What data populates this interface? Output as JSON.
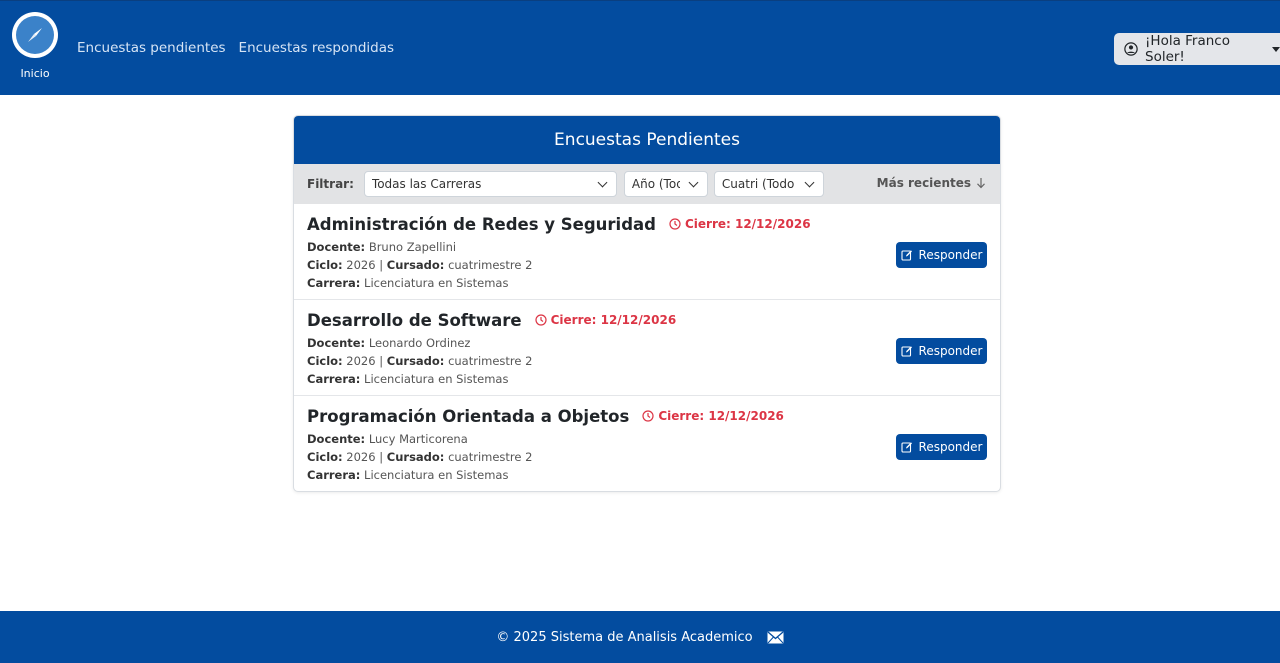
{
  "navbar": {
    "home_label": "Inicio",
    "links": [
      "Encuestas pendientes",
      "Encuestas respondidas"
    ],
    "user_greeting": "¡Hola Franco Soler!"
  },
  "card": {
    "title": "Encuestas Pendientes",
    "filter_label": "Filtrar:",
    "filters": {
      "carreras": "Todas las Carreras",
      "anio": "Año (Todos)",
      "cuatri": "Cuatri (Todos)"
    },
    "sort_label": "Más recientes"
  },
  "labels": {
    "docente": "Docente:",
    "ciclo": "Ciclo:",
    "cursado": "Cursado:",
    "carrera": "Carrera:",
    "responder": "Responder"
  },
  "encuestas": [
    {
      "materia": "Administración de Redes y Seguridad",
      "cierre": "Cierre: 12/12/2026",
      "docente": "Bruno Zapellini",
      "ciclo": "2026",
      "cursado": "cuatrimestre 2",
      "carrera": "Licenciatura en Sistemas"
    },
    {
      "materia": "Desarrollo de Software",
      "cierre": "Cierre: 12/12/2026",
      "docente": "Leonardo Ordinez",
      "ciclo": "2026",
      "cursado": "cuatrimestre 2",
      "carrera": "Licenciatura en Sistemas"
    },
    {
      "materia": "Programación Orientada a Objetos",
      "cierre": "Cierre: 12/12/2026",
      "docente": "Lucy Marticorena",
      "ciclo": "2026",
      "cursado": "cuatrimestre 2",
      "carrera": "Licenciatura en Sistemas"
    }
  ],
  "footer": {
    "text": "© 2025 Sistema de Analisis Academico"
  },
  "colors": {
    "primary": "#034c9f",
    "danger": "#dc3545",
    "filter_bg": "#e2e3e5"
  },
  "icons": [
    "compass-logo-icon",
    "user-circle-icon",
    "caret-down-icon",
    "chevron-down-icon",
    "arrow-down-icon",
    "clock-icon",
    "edit-icon",
    "envelope-icon"
  ]
}
